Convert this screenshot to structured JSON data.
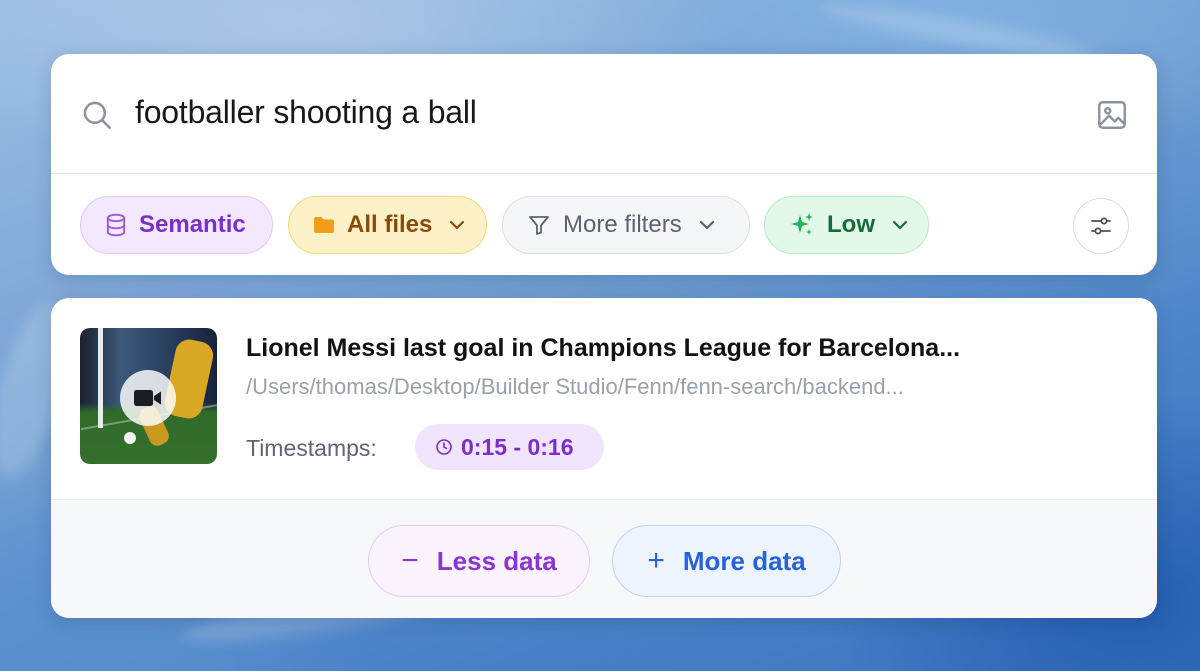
{
  "search": {
    "query": "footballer shooting a ball",
    "icon": "search-icon",
    "image_icon": "image-icon"
  },
  "filters": {
    "mode_label": "Semantic",
    "files_label": "All files",
    "more_filters_label": "More filters",
    "quality_label": "Low"
  },
  "result": {
    "title": "Lionel Messi last goal in Champions League for Barcelona...",
    "path": "/Users/thomas/Desktop/Builder Studio/Fenn/fenn-search/backend...",
    "timestamps_label": "Timestamps:",
    "timestamp": "0:15 - 0:16",
    "media_type_icon": "video-camera-icon"
  },
  "footer": {
    "less_label": "Less data",
    "more_label": "More data",
    "less_symbol": "−",
    "more_symbol": "+"
  },
  "colors": {
    "semantic": "#7a2fc7",
    "files": "#8a4a0c",
    "low": "#166b3a",
    "less": "#8a35d4",
    "more": "#2763d8"
  }
}
